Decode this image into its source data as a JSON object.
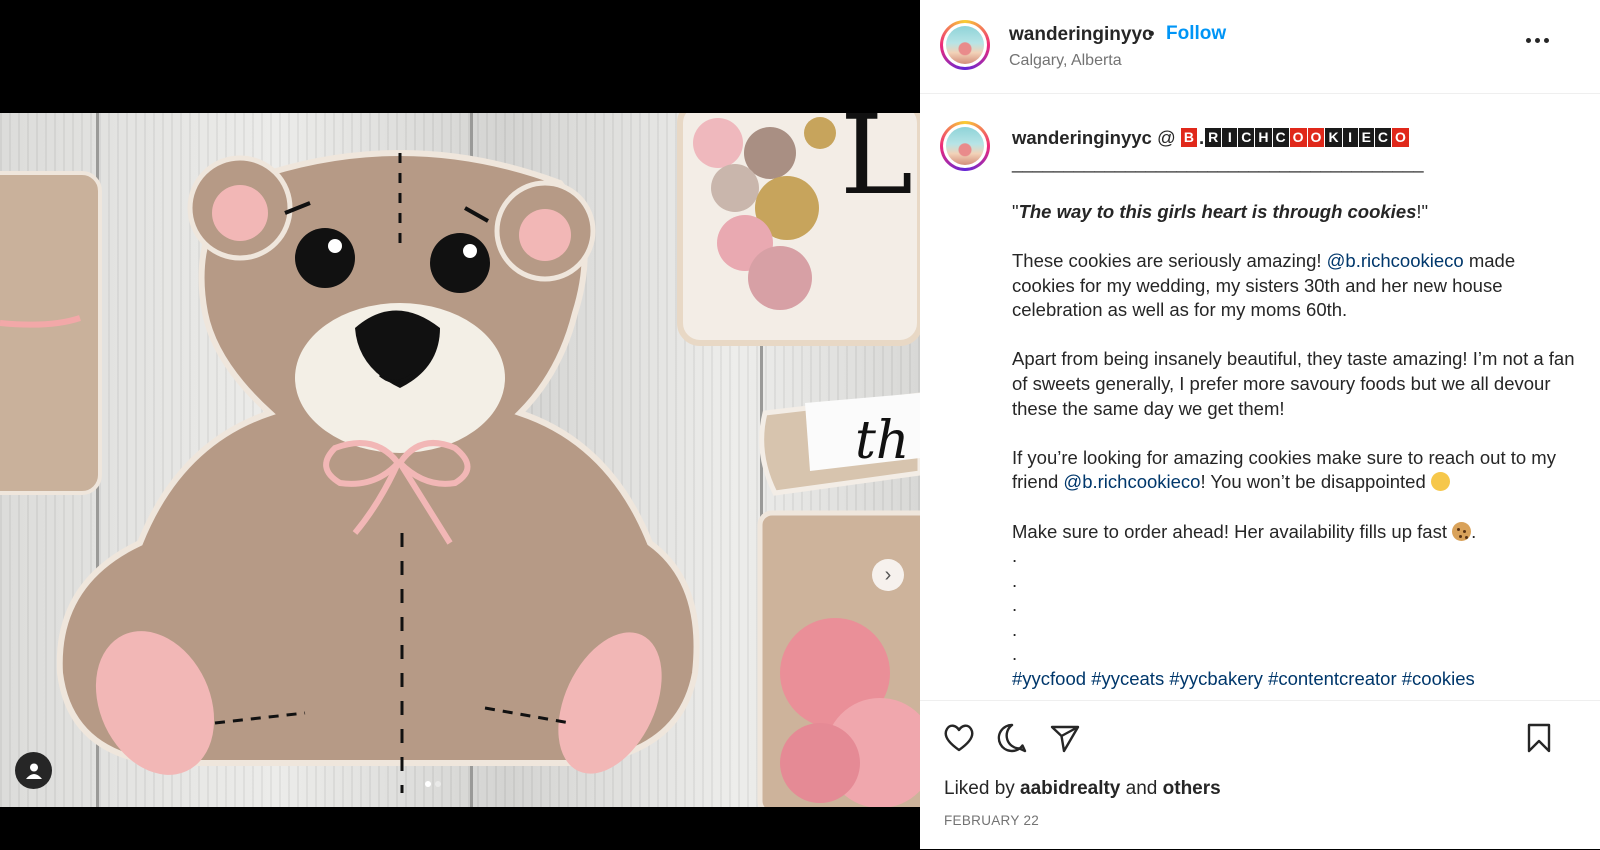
{
  "post": {
    "header": {
      "username": "wanderinginyyc",
      "separator": "•",
      "follow_label": "Follow",
      "location": "Calgary, Alberta"
    },
    "caption": {
      "username": "wanderinginyyc",
      "at_sign": "@",
      "mention_boxes": [
        "B",
        ".",
        "R",
        "I",
        "C",
        "H",
        "C",
        "O",
        "O",
        "K",
        "I",
        "E",
        "C",
        "O"
      ],
      "divider": "________________________________________",
      "quote_open": "\"",
      "quote_text": "The way to this girls heart is through cookies",
      "quote_close": "!\"",
      "p1_a": "These cookies are seriously amazing! ",
      "p1_mention": "@b.richcookieco",
      "p1_b": " made cookies for my wedding, my sisters 30th and her new house celebration as well as for my moms 60th.",
      "p2": "Apart from being insanely beautiful, they taste amazing! I’m not a fan of sweets generally, I prefer more savoury foods but we all devour these the same day we get them!",
      "p3_a": "If you’re looking for amazing cookies make sure to reach out to my friend ",
      "p3_mention": "@b.richcookieco",
      "p3_b": "! You won’t be disappointed ",
      "p4": "Make sure to order ahead! Her availability fills up fast ",
      "p4_end": ".",
      "dot_lines": [
        ".",
        ".",
        ".",
        ".",
        "."
      ],
      "hashtags": [
        "#yycfood",
        "#yyceats",
        "#yycbakery",
        "#contentcreator",
        "#cookies"
      ]
    },
    "liked_by": {
      "prefix": "Liked by ",
      "user": "aabidrealty",
      "middle": " and ",
      "others": "others"
    },
    "date": "FEBRUARY 22",
    "icons": {
      "like": "heart-icon",
      "comment": "comment-icon",
      "share": "paper-plane-icon",
      "save": "bookmark-icon",
      "more": "more-options-icon",
      "tag": "user-tag-icon",
      "next": "chevron-right-icon"
    },
    "carousel": {
      "total": 2,
      "active": 1
    },
    "colors": {
      "follow": "#0095f6",
      "link": "#00376b",
      "text": "#262626",
      "muted": "#737373"
    }
  }
}
